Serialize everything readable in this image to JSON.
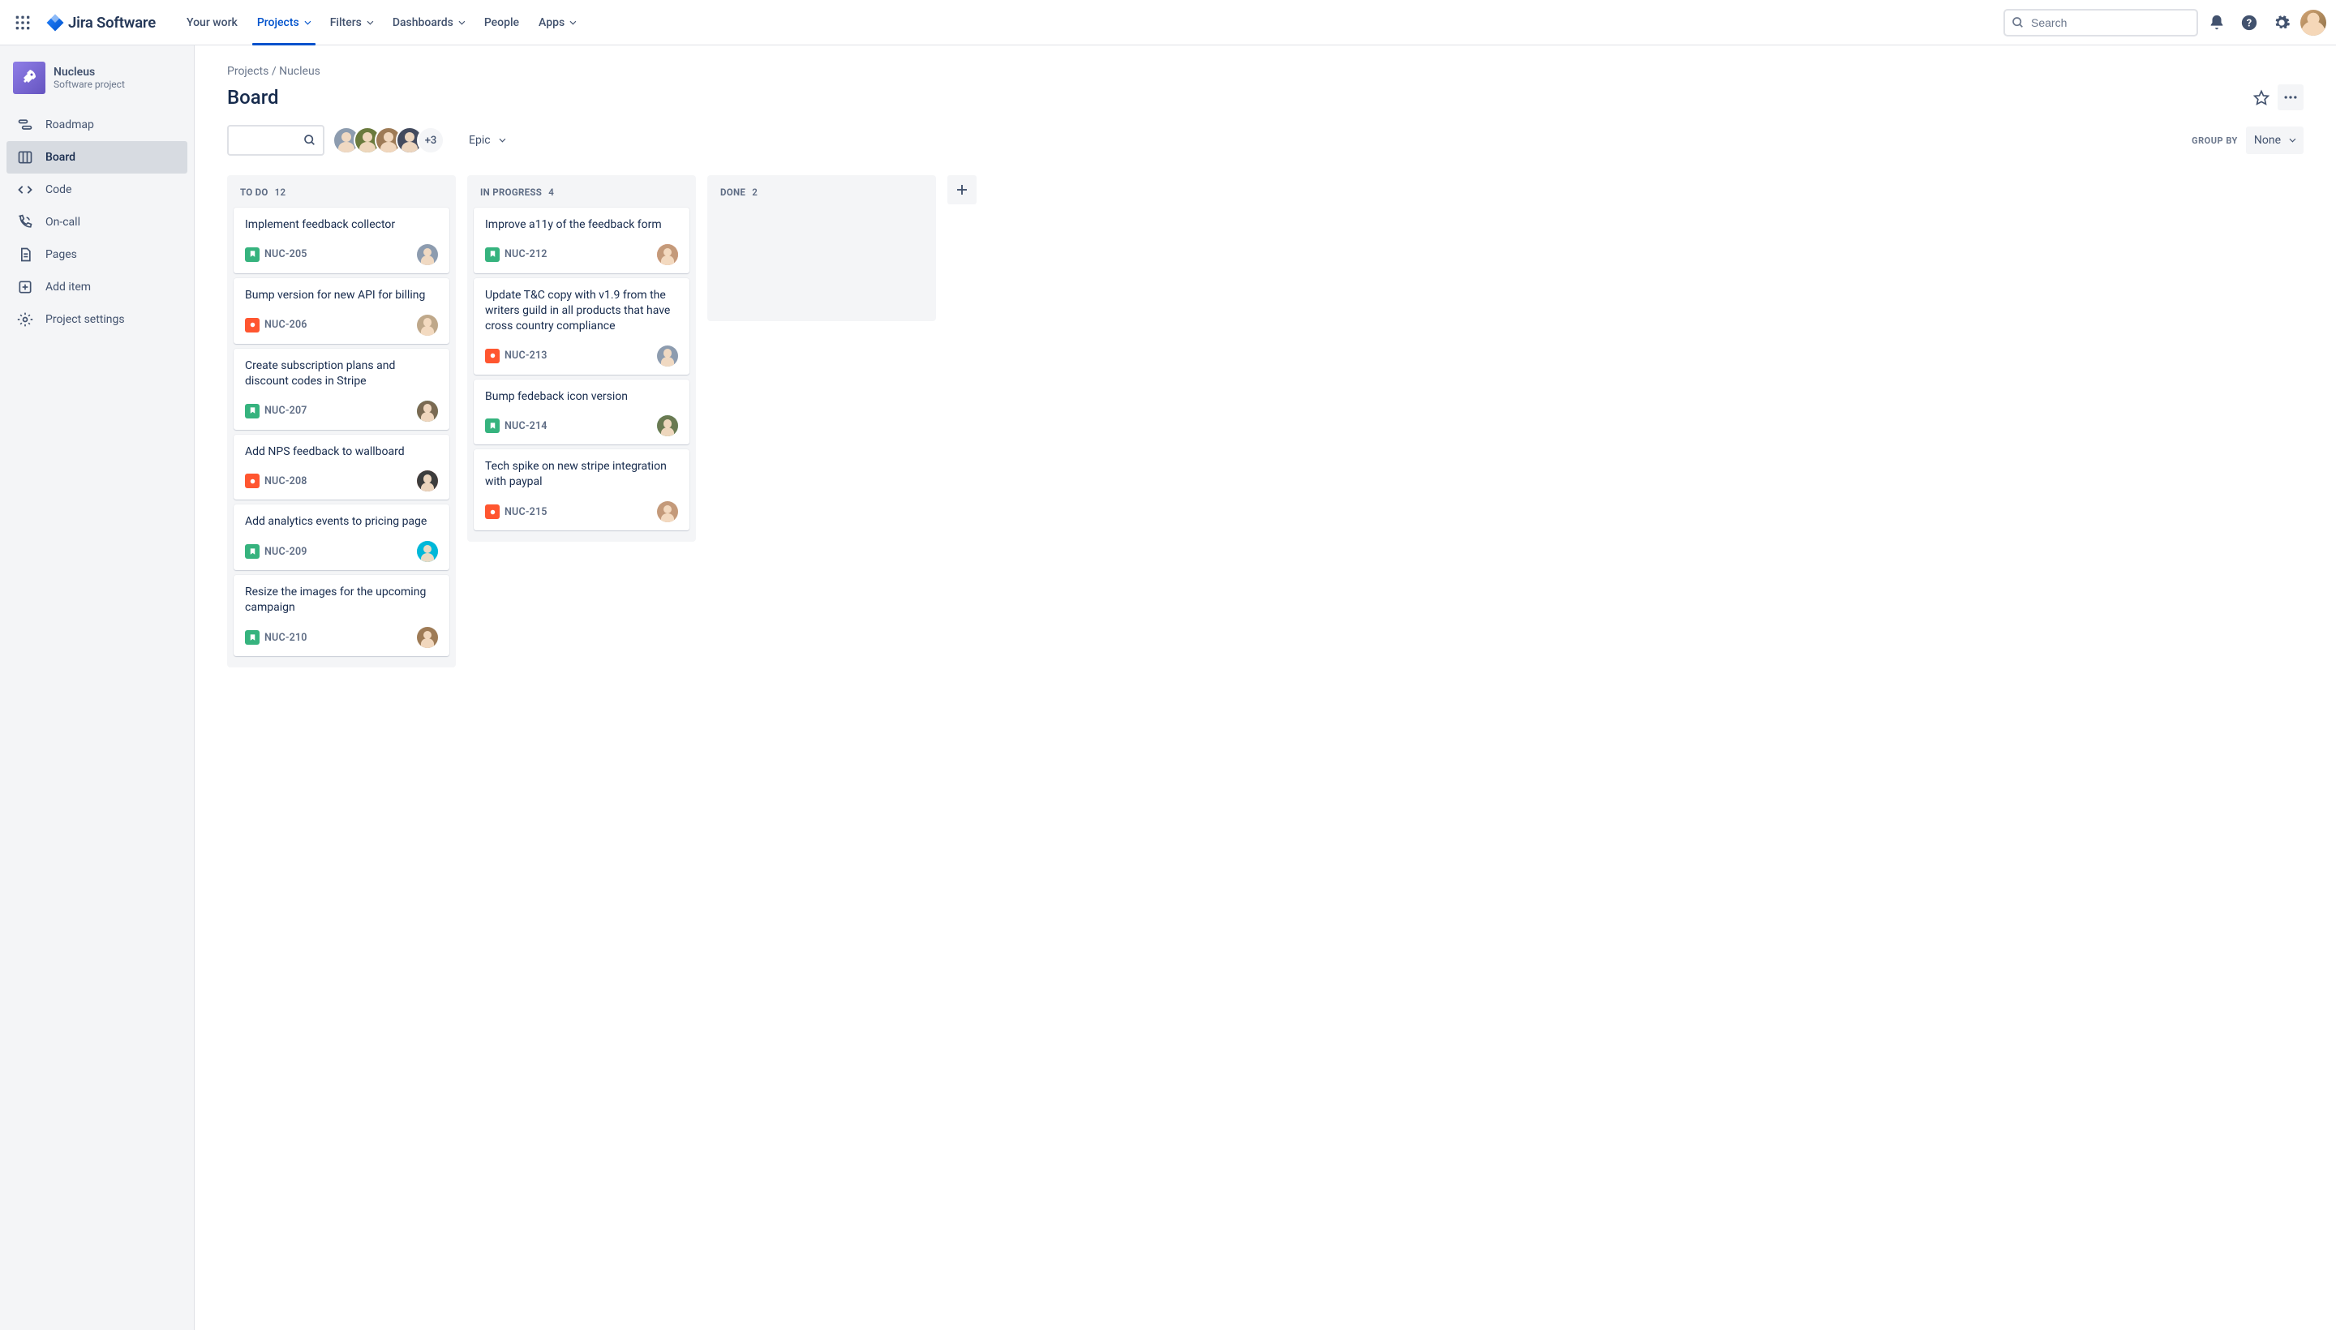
{
  "app": {
    "logo_text": "Jira Software"
  },
  "nav": {
    "your_work": "Your work",
    "projects": "Projects",
    "filters": "Filters",
    "dashboards": "Dashboards",
    "people": "People",
    "apps": "Apps"
  },
  "search": {
    "placeholder": "Search"
  },
  "project": {
    "name": "Nucleus",
    "type": "Software project"
  },
  "sidebar": {
    "roadmap": "Roadmap",
    "board": "Board",
    "code": "Code",
    "on_call": "On-call",
    "pages": "Pages",
    "add_item": "Add item",
    "project_settings": "Project settings"
  },
  "breadcrumb": {
    "projects": "Projects",
    "sep": " / ",
    "current": "Nucleus"
  },
  "page": {
    "title": "Board"
  },
  "filters": {
    "avatar_overflow": "+3",
    "epic": "Epic",
    "group_by_label": "GROUP BY",
    "group_by_value": "None"
  },
  "columns": {
    "todo": {
      "label": "TO DO",
      "count": "12"
    },
    "in_progress": {
      "label": "IN PROGRESS",
      "count": "4"
    },
    "done": {
      "label": "DONE",
      "count": "2"
    }
  },
  "cards": {
    "todo": [
      {
        "title": "Implement feedback collector",
        "key": "NUC-205",
        "type": "story",
        "assignee": "a1",
        "ring": ""
      },
      {
        "title": "Bump version for new API for billing",
        "key": "NUC-206",
        "type": "bug",
        "assignee": "a2",
        "ring": ""
      },
      {
        "title": "Create subscription plans and discount codes in Stripe",
        "key": "NUC-207",
        "type": "story",
        "assignee": "a3",
        "ring": "ring-g"
      },
      {
        "title": "Add NPS feedback to wallboard",
        "key": "NUC-208",
        "type": "bug",
        "assignee": "a4",
        "ring": "ring-r"
      },
      {
        "title": "Add analytics events to pricing page",
        "key": "NUC-209",
        "type": "story",
        "assignee": "a5",
        "ring": "ring-b"
      },
      {
        "title": "Resize the images for the upcoming campaign",
        "key": "NUC-210",
        "type": "story",
        "assignee": "a6",
        "ring": ""
      }
    ],
    "in_progress": [
      {
        "title": "Improve a11y of the feedback form",
        "key": "NUC-212",
        "type": "story",
        "assignee": "b1",
        "ring": "ring-r"
      },
      {
        "title": "Update T&C copy with v1.9 from the writers guild in all products that have cross country compliance",
        "key": "NUC-213",
        "type": "bug",
        "assignee": "b2",
        "ring": ""
      },
      {
        "title": "Bump fedeback icon version",
        "key": "NUC-214",
        "type": "story",
        "assignee": "b3",
        "ring": "ring-g"
      },
      {
        "title": "Tech spike on new stripe integration with paypal",
        "key": "NUC-215",
        "type": "bug",
        "assignee": "b4",
        "ring": ""
      }
    ]
  },
  "avatar_colors": {
    "a1": "#8d9caf",
    "a2": "#bfa88a",
    "a3": "#7a6a52",
    "a4": "#3d3d3d",
    "a5": "#00B8D9",
    "a6": "#9e7b56",
    "b1": "#c49a7a",
    "b2": "#8d9caf",
    "b3": "#6a7a52",
    "b4": "#c49a7a",
    "s1": "#8d9caf",
    "s2": "#6a7a3d",
    "s3": "#9e7b56",
    "s4": "#424a5e"
  }
}
